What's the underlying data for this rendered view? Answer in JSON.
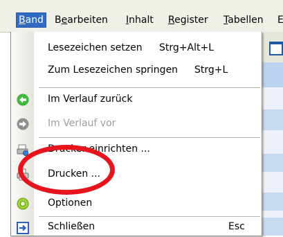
{
  "menubar": {
    "items": [
      {
        "label": "Band",
        "accel": "B",
        "rest": "and"
      },
      {
        "label": "Bearbeiten",
        "pre": "B",
        "accel": "e",
        "rest": "arbeiten"
      },
      {
        "label": "Inhalt",
        "accel": "I",
        "rest": "nhalt"
      },
      {
        "label": "Register",
        "accel": "R",
        "rest": "egister"
      },
      {
        "label": "Tabellen",
        "accel": "T",
        "rest": "abellen"
      },
      {
        "label": "E"
      }
    ]
  },
  "menu": {
    "items": [
      {
        "label": "Lesezeichen setzen",
        "shortcut": "Strg+Alt+L"
      },
      {
        "label": "Zum Lesezeichen springen",
        "shortcut": "Strg+L"
      },
      {
        "label": "Im Verlauf zurück",
        "icon": "back-arrow-icon"
      },
      {
        "label": "Im Verlauf vor",
        "icon": "forward-arrow-icon",
        "disabled": true
      },
      {
        "label": "Drucker einrichten ...",
        "icon": "printer-setup-icon"
      },
      {
        "label": "Drucken ...",
        "icon": "printer-icon"
      },
      {
        "label": "Optionen",
        "icon": "options-icon"
      },
      {
        "label": "Schließen",
        "shortcut": "Esc",
        "icon": "exit-icon"
      }
    ]
  },
  "colors": {
    "accent": "#316ac5",
    "annotation": "#e8141d",
    "back_icon": "#2e9b2e",
    "disabled_icon": "#8f8f8f"
  }
}
